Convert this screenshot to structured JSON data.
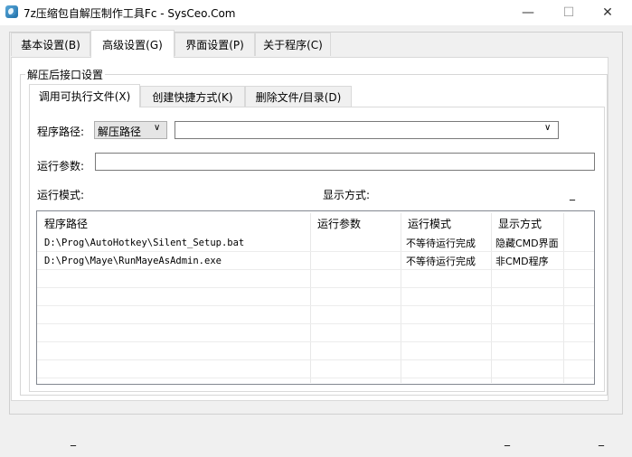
{
  "window": {
    "title": "7z压缩包自解压制作工具Fc - SysCeo.Com",
    "minimize": "—",
    "maximize": "☐",
    "close": "✕"
  },
  "tabs": [
    {
      "label": "基本设置(B)",
      "active": false
    },
    {
      "label": "高级设置(G)",
      "active": true
    },
    {
      "label": "界面设置(P)",
      "active": false
    },
    {
      "label": "关于程序(C)",
      "active": false
    }
  ],
  "group": {
    "title": "解压后接口设置"
  },
  "inner_tabs": [
    {
      "label": "调用可执行文件(X)",
      "active": true
    },
    {
      "label": "创建快捷方式(K)",
      "active": false
    },
    {
      "label": "删除文件/目录(D)",
      "active": false
    }
  ],
  "form": {
    "path_label": "程序路径:",
    "path_type_value": "解压路径",
    "path_value": "",
    "args_label": "运行参数:",
    "args_value": "",
    "run_mode_label": "运行模式:",
    "display_label": "显示方式:",
    "dash": "_"
  },
  "list": {
    "columns": [
      "程序路径",
      "运行参数",
      "运行模式",
      "显示方式"
    ],
    "rows": [
      {
        "path": "D:\\Prog\\AutoHotkey\\Silent_Setup.bat",
        "args": "",
        "mode": "不等待运行完成",
        "display": "隐藏CMD界面"
      },
      {
        "path": "D:\\Prog\\Maye\\RunMayeAsAdmin.exe",
        "args": "",
        "mode": "不等待运行完成",
        "display": "非CMD程序"
      }
    ]
  },
  "status_bar": {
    "left": "_",
    "mid": "_",
    "right": "_"
  },
  "colors": {
    "accent": "#1d6fa8",
    "window_bg": "#f0f0f0",
    "panel_bg": "#ffffff"
  }
}
